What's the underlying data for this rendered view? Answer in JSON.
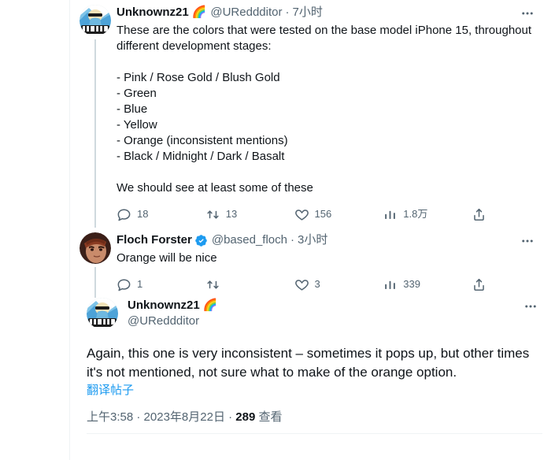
{
  "colors": {
    "accent": "#1d9bf0",
    "text": "#0f1419",
    "muted": "#536471",
    "divider": "#eff3f4",
    "thread_line": "#cfd9de"
  },
  "tweets": [
    {
      "display_name": "Unknownz21",
      "name_emoji": "🌈",
      "handle": "@UReddditor",
      "separator": "·",
      "timestamp": "7小时",
      "text": "These are the colors that were tested on the base model iPhone 15, throughout different development stages:\n\n- Pink / Rose Gold / Blush Gold\n- Green\n- Blue\n- Yellow\n- Orange (inconsistent mentions)\n- Black / Midnight / Dark / Basalt\n\nWe should see at least some of these",
      "verified": false,
      "actions": {
        "reply_label": "18",
        "retweet_label": "13",
        "like_label": "156",
        "views_label": "1.8万",
        "share_label": ""
      }
    },
    {
      "display_name": "Floch Forster",
      "name_emoji": "",
      "handle": "@based_floch",
      "separator": "·",
      "timestamp": "3小时",
      "text": "Orange will be nice",
      "verified": true,
      "actions": {
        "reply_label": "1",
        "retweet_label": "",
        "like_label": "3",
        "views_label": "339",
        "share_label": ""
      }
    },
    {
      "display_name": "Unknownz21",
      "name_emoji": "🌈",
      "handle": "@UReddditor",
      "text": "Again, this one is very inconsistent – sometimes it pops up, but other times it's not mentioned, not sure what to make of the orange option.",
      "translate_label": "翻译帖子",
      "verified": false,
      "meta": {
        "time": "上午3:58",
        "sep1": " · ",
        "date": "2023年8月22日",
        "sep2": " · ",
        "views_count": "289",
        "views_word": " 查看"
      }
    }
  ],
  "icons": {
    "more": "more-options-icon",
    "reply": "reply-icon",
    "retweet": "retweet-icon",
    "like": "like-icon",
    "views": "views-icon",
    "share": "share-icon",
    "verified": "verified-badge-icon"
  }
}
